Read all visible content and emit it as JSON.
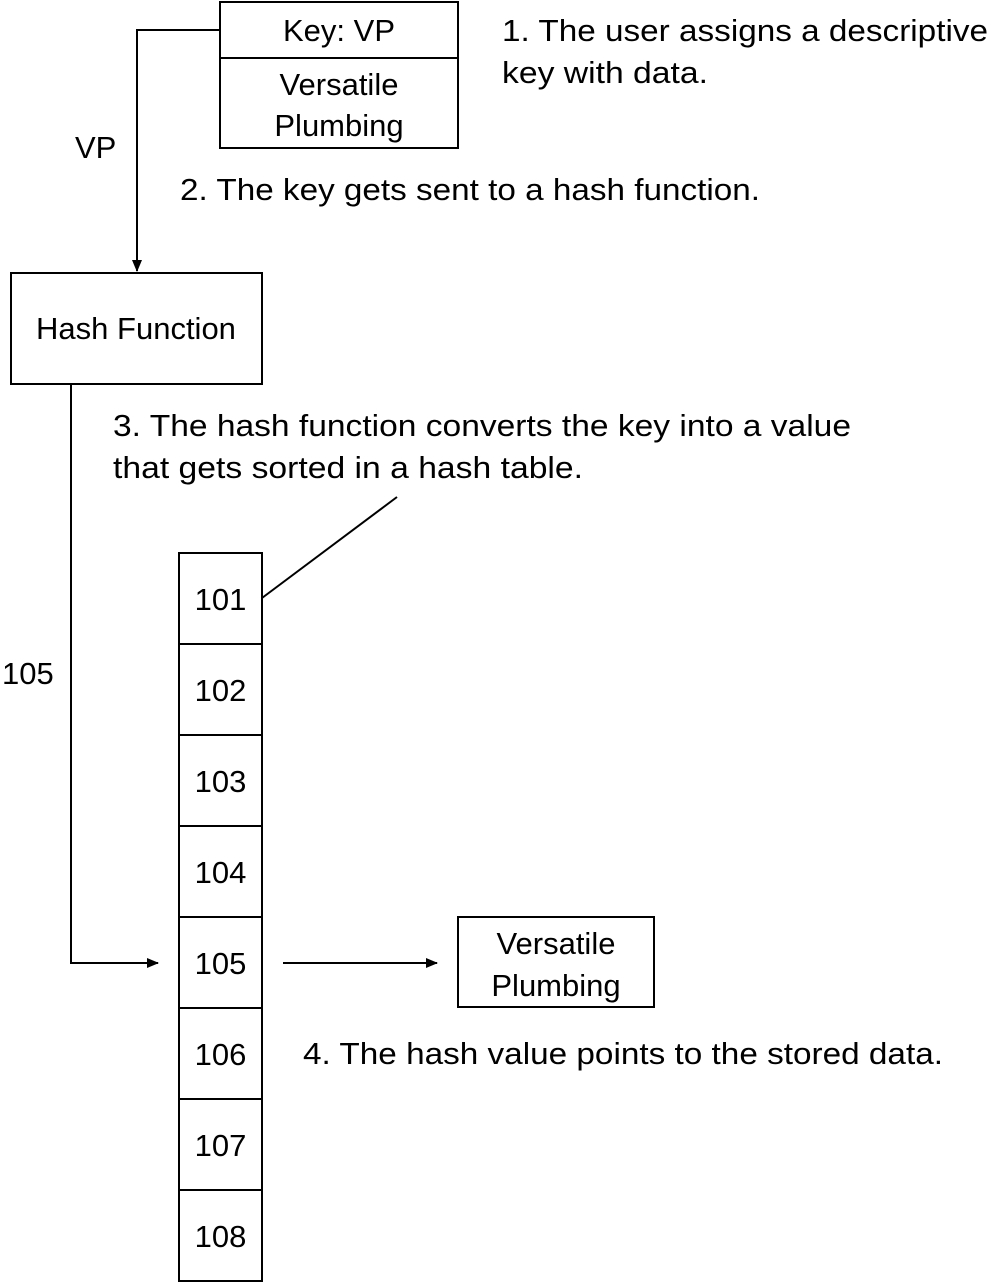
{
  "key_box": {
    "key_label": "Key: VP",
    "data_line1": "Versatile",
    "data_line2": "Plumbing"
  },
  "edge_key_to_hash": {
    "label": "VP"
  },
  "hash_function": {
    "label": "Hash Function"
  },
  "edge_hash_to_table": {
    "label": "105"
  },
  "hash_table": {
    "slots": [
      "101",
      "102",
      "103",
      "104",
      "105",
      "106",
      "107",
      "108"
    ]
  },
  "stored_data": {
    "line1": "Versatile",
    "line2": "Plumbing"
  },
  "steps": {
    "step1": [
      "1. The user assigns a descriptive",
      "key with data."
    ],
    "step2": [
      "2. The key gets sent to a hash function."
    ],
    "step3": [
      "3. The hash function converts the key into a value",
      "that gets sorted in a hash table."
    ],
    "step4": [
      "4. The hash value points to the stored data."
    ]
  }
}
